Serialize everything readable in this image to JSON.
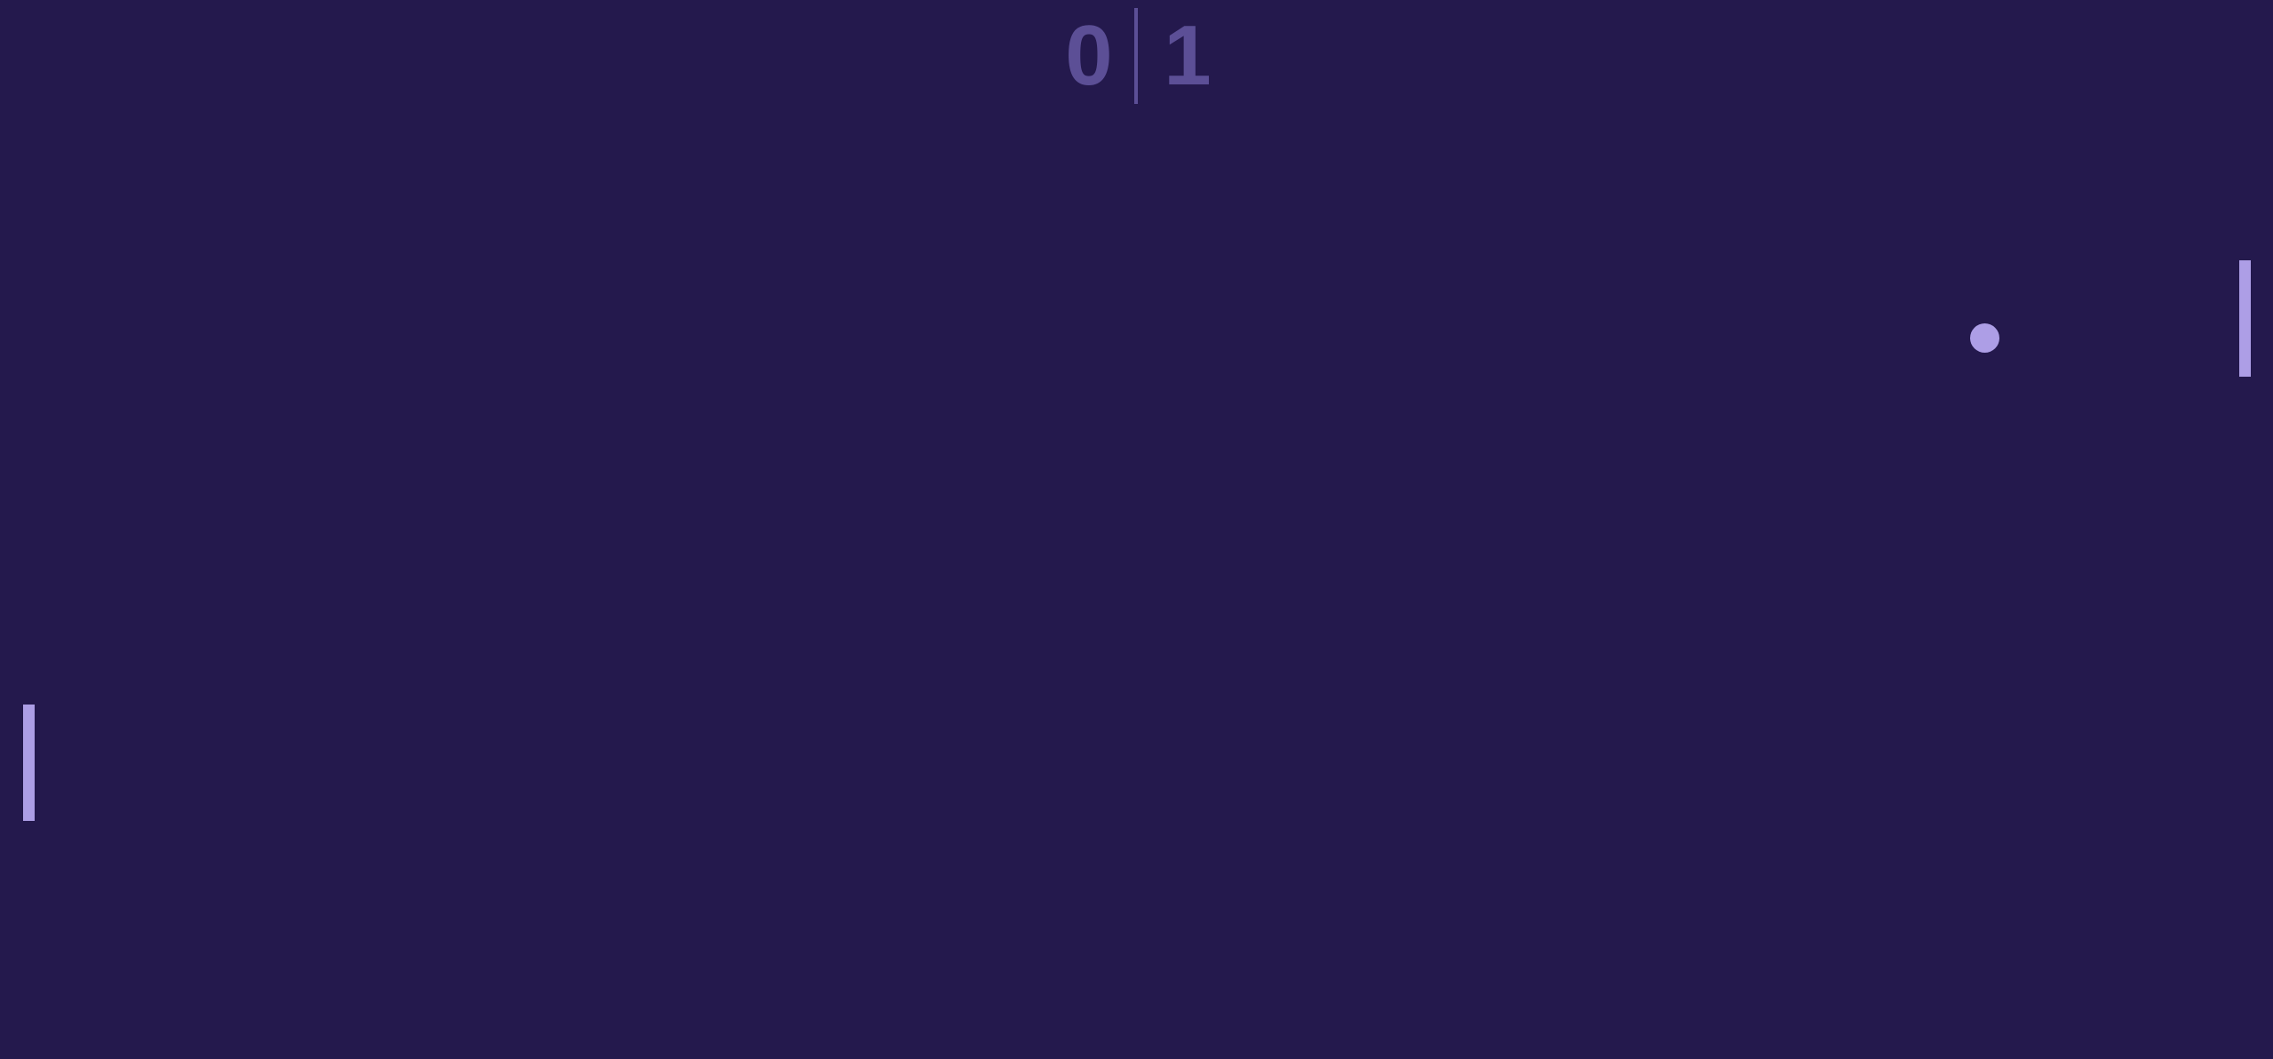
{
  "game": {
    "type": "pong"
  },
  "scoreboard": {
    "left_score": "0",
    "right_score": "1"
  },
  "colors": {
    "background": "#24194d",
    "score_text": "#5c4f96",
    "divider": "#5c4f96",
    "paddle": "#ad9ee6",
    "ball": "#ad9ee6"
  }
}
